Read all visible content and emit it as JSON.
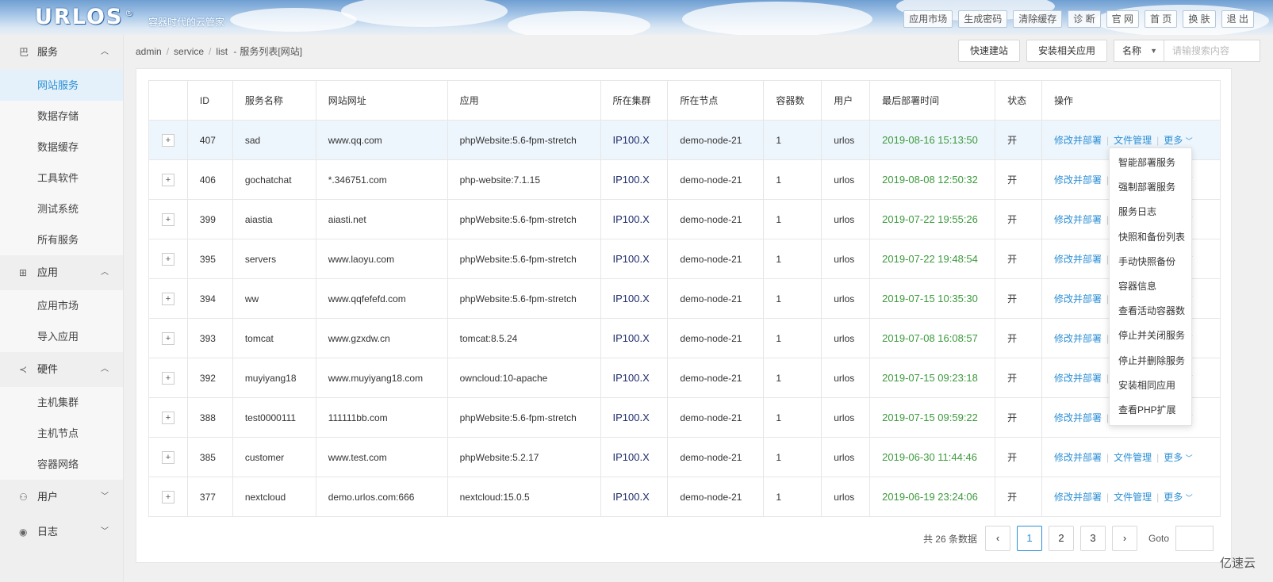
{
  "brand": {
    "logo": "URLOS",
    "reg": "®",
    "slogan": "容器时代的云管家"
  },
  "topbar": [
    "应用市场",
    "生成密码",
    "清除缓存",
    "诊 断",
    "官 网",
    "首 页",
    "换 肤",
    "退 出"
  ],
  "sidebar": {
    "groups": [
      {
        "icon": "巴",
        "label": "服务",
        "chev": "︿",
        "items": [
          "网站服务",
          "数据存储",
          "数据缓存",
          "工具软件",
          "测试系统",
          "所有服务"
        ]
      },
      {
        "icon": "⊞",
        "label": "应用",
        "chev": "︿",
        "items": [
          "应用市场",
          "导入应用"
        ]
      },
      {
        "icon": "≺",
        "label": "硬件",
        "chev": "︿",
        "items": [
          "主机集群",
          "主机节点",
          "容器网络"
        ]
      },
      {
        "icon": "⚇",
        "label": "用户",
        "chev": "﹀",
        "items": []
      },
      {
        "icon": "◉",
        "label": "日志",
        "chev": "﹀",
        "items": []
      }
    ]
  },
  "breadcrumb": {
    "p1": "admin",
    "p2": "service",
    "p3": "list",
    "dash": "-",
    "current": "服务列表[网站]"
  },
  "actions": {
    "quick": "快速建站",
    "install": "安装相关应用",
    "select": "名称",
    "placeholder": "请输搜索内容"
  },
  "table": {
    "headers": [
      "ID",
      "服务名称",
      "网站网址",
      "应用",
      "所在集群",
      "所在节点",
      "容器数",
      "用户",
      "最后部署时间",
      "状态",
      "操作"
    ],
    "rows": [
      [
        "407",
        "sad",
        "www.qq.com",
        "phpWebsite:5.6-fpm-stretch",
        "IP100.X",
        "demo-node-21",
        "1",
        "urlos",
        "2019-08-16 15:13:50",
        "开"
      ],
      [
        "406",
        "gochatchat",
        "*.346751.com",
        "php-website:7.1.15",
        "IP100.X",
        "demo-node-21",
        "1",
        "urlos",
        "2019-08-08 12:50:32",
        "开"
      ],
      [
        "399",
        "aiastia",
        "aiasti.net",
        "phpWebsite:5.6-fpm-stretch",
        "IP100.X",
        "demo-node-21",
        "1",
        "urlos",
        "2019-07-22 19:55:26",
        "开"
      ],
      [
        "395",
        "servers",
        "www.laoyu.com",
        "phpWebsite:5.6-fpm-stretch",
        "IP100.X",
        "demo-node-21",
        "1",
        "urlos",
        "2019-07-22 19:48:54",
        "开"
      ],
      [
        "394",
        "ww",
        "www.qqfefefd.com",
        "phpWebsite:5.6-fpm-stretch",
        "IP100.X",
        "demo-node-21",
        "1",
        "urlos",
        "2019-07-15 10:35:30",
        "开"
      ],
      [
        "393",
        "tomcat",
        "www.gzxdw.cn",
        "tomcat:8.5.24",
        "IP100.X",
        "demo-node-21",
        "1",
        "urlos",
        "2019-07-08 16:08:57",
        "开"
      ],
      [
        "392",
        "muyiyang18",
        "www.muyiyang18.com",
        "owncloud:10-apache",
        "IP100.X",
        "demo-node-21",
        "1",
        "urlos",
        "2019-07-15 09:23:18",
        "开"
      ],
      [
        "388",
        "test0000111",
        "111111bb.com",
        "phpWebsite:5.6-fpm-stretch",
        "IP100.X",
        "demo-node-21",
        "1",
        "urlos",
        "2019-07-15 09:59:22",
        "开"
      ],
      [
        "385",
        "customer",
        "www.test.com",
        "phpWebsite:5.2.17",
        "IP100.X",
        "demo-node-21",
        "1",
        "urlos",
        "2019-06-30 11:44:46",
        "开"
      ],
      [
        "377",
        "nextcloud",
        "demo.urlos.com:666",
        "nextcloud:15.0.5",
        "IP100.X",
        "demo-node-21",
        "1",
        "urlos",
        "2019-06-19 23:24:06",
        "开"
      ]
    ],
    "expand": "+",
    "ops": {
      "redeploy": "修改并部署",
      "files": "文件管理",
      "more": "更多",
      "more_chev": "﹀"
    }
  },
  "dropdown": [
    "智能部署服务",
    "强制部署服务",
    "服务日志",
    "快照和备份列表",
    "手动快照备份",
    "容器信息",
    "查看活动容器数",
    "停止并关闭服务",
    "停止并删除服务",
    "安装相同应用",
    "查看PHP扩展"
  ],
  "pagination": {
    "total": "共 26 条数据",
    "prev": "‹",
    "next": "›",
    "pages": [
      "1",
      "2",
      "3"
    ],
    "current": "1",
    "goto": "Goto"
  },
  "watermark": "亿速云"
}
